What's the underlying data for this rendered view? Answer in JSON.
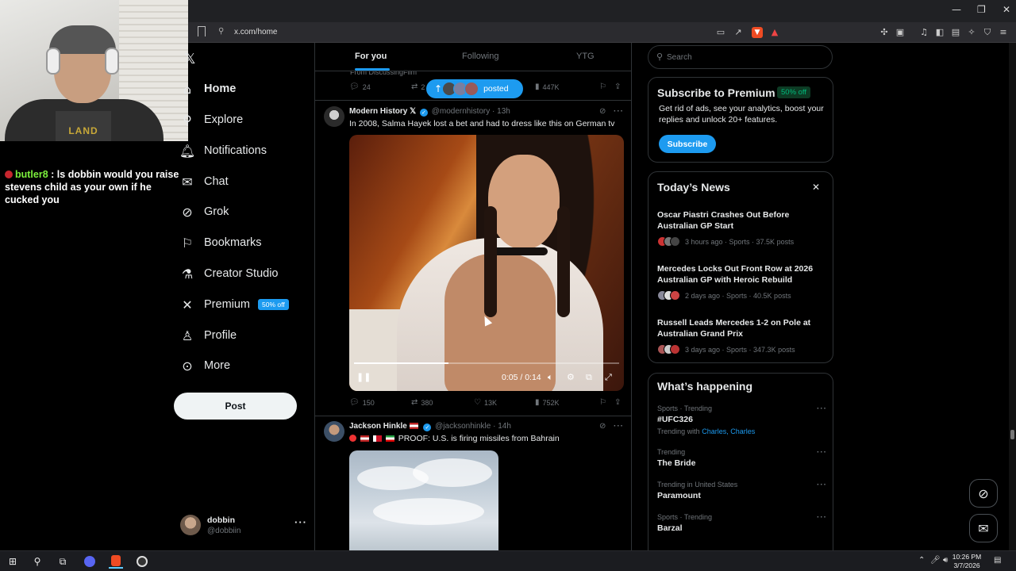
{
  "browser": {
    "url": "x.com/home"
  },
  "chat_overlay": {
    "username": "butler8",
    "separator": " : ",
    "message": "ls dobbin would you raise stevens child as your own if he cucked you"
  },
  "webcam": {
    "shirt_text": "LAND"
  },
  "nav": {
    "items": [
      {
        "label": "Home",
        "icon": "home-icon",
        "active": true
      },
      {
        "label": "Explore",
        "icon": "search-icon"
      },
      {
        "label": "Notifications",
        "icon": "bell-icon"
      },
      {
        "label": "Chat",
        "icon": "mail-icon"
      },
      {
        "label": "Grok",
        "icon": "grok-icon"
      },
      {
        "label": "Bookmarks",
        "icon": "bookmark-icon"
      },
      {
        "label": "Creator Studio",
        "icon": "flask-icon"
      },
      {
        "label": "Premium",
        "icon": "x-icon",
        "badge": "50% off"
      },
      {
        "label": "Profile",
        "icon": "person-icon"
      },
      {
        "label": "More",
        "icon": "more-circle-icon"
      }
    ],
    "post_label": "Post",
    "account": {
      "name": "dobbin",
      "handle": "@dobbiin"
    }
  },
  "feed": {
    "tabs": [
      "For you",
      "Following",
      "YTG"
    ],
    "active_tab": 0,
    "previous_post": {
      "from_text": "From DiscussingFilm",
      "replies": "24",
      "reposts": "2",
      "views": "447K"
    },
    "posted_pill": {
      "label": "posted"
    },
    "tweets": [
      {
        "name": "Modern History",
        "name_suffix": "𝕏",
        "handle": "@modernhistory",
        "time": "13h",
        "text": "In 2008, Salma Hayek lost a bet and had to dress like this on German tv",
        "video": {
          "time": "0:05 / 0:14",
          "progress": 0.357
        },
        "replies": "150",
        "reposts": "380",
        "likes": "13K",
        "views": "752K"
      },
      {
        "name": "Jackson Hinkle",
        "handle": "@jacksonhinkle",
        "time": "14h",
        "text": "PROOF: U.S. is firing missiles from Bahrain"
      }
    ]
  },
  "sidebar": {
    "search_placeholder": "Search",
    "premium": {
      "title": "Subscribe to Premium",
      "badge": "50% off",
      "description": "Get rid of ads, see your analytics, boost your replies and unlock 20+ features.",
      "button": "Subscribe"
    },
    "news": {
      "title": "Today’s News",
      "items": [
        {
          "headline": "Oscar Piastri Crashes Out Before Australian GP Start",
          "meta": "3 hours ago · Sports · 37.5K posts"
        },
        {
          "headline": "Mercedes Locks Out Front Row at 2026 Australian GP with Heroic Rebuild",
          "meta": "2 days ago · Sports · 40.5K posts"
        },
        {
          "headline": "Russell Leads Mercedes 1-2 on Pole at Australian Grand Prix",
          "meta": "3 days ago · Sports · 347.3K posts"
        }
      ]
    },
    "happening": {
      "title": "What’s happening",
      "trends": [
        {
          "context": "Sports · Trending",
          "name": "#UFC326",
          "with_label": "Trending with",
          "with_links": "Charles, Charles"
        },
        {
          "context": "Trending",
          "name": "The Bride"
        },
        {
          "context": "Trending in United States",
          "name": "Paramount"
        },
        {
          "context": "Sports · Trending",
          "name": "Barzal"
        }
      ]
    }
  },
  "taskbar": {
    "time": "10:26 PM",
    "date": "3/7/2026"
  },
  "colors": {
    "accent": "#1d9bf0",
    "background": "#000000",
    "border": "#2f3336",
    "muted": "#71767b",
    "chat_user": "#7cf03c"
  }
}
